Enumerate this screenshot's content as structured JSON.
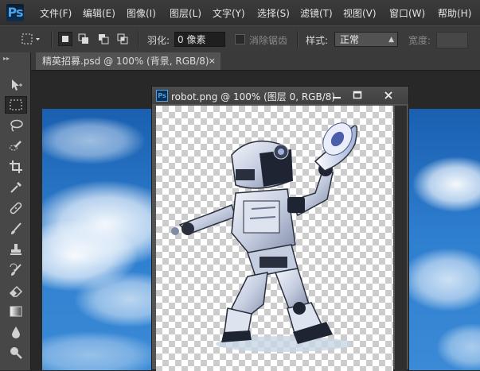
{
  "app": {
    "logo": "Ps"
  },
  "menu": [
    "文件(F)",
    "编辑(E)",
    "图像(I)",
    "图层(L)",
    "文字(Y)",
    "选择(S)",
    "滤镜(T)",
    "视图(V)",
    "窗口(W)",
    "帮助(H)"
  ],
  "options": {
    "feather_label": "羽化:",
    "feather_value": "0 像素",
    "antialias_label": "消除锯齿",
    "style_label": "样式:",
    "style_value": "正常",
    "width_label": "宽度:"
  },
  "document_tab": {
    "title": "精英招募.psd @ 100% (背景, RGB/8)",
    "close": "×"
  },
  "robot_window": {
    "title": "robot.png @ 100% (图层 0, RGB/8)"
  },
  "tools": [
    "move-tool",
    "marquee-tool",
    "lasso-tool",
    "quick-selection-tool",
    "crop-tool",
    "eyedropper-tool",
    "healing-brush-tool",
    "brush-tool",
    "clone-stamp-tool",
    "history-brush-tool",
    "eraser-tool",
    "gradient-tool",
    "blur-tool",
    "dodge-tool"
  ],
  "colors": {
    "accent": "#4aa3e8",
    "menu_bg": "#353535",
    "panel_bg": "#474747",
    "sky": "#2f7fd0"
  }
}
